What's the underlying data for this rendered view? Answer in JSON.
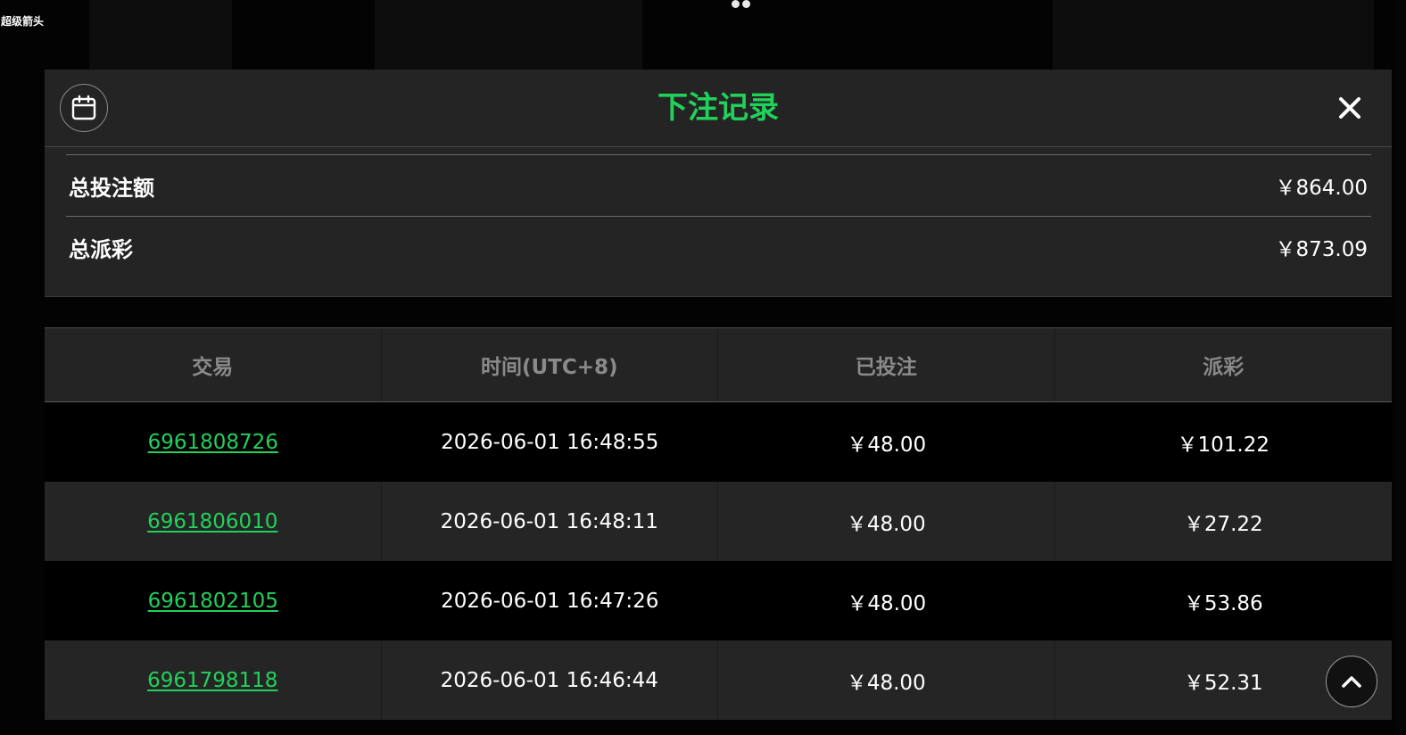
{
  "app": {
    "title": "超级箭头"
  },
  "modal": {
    "title": "下注记录",
    "calendar_icon": "calendar-icon",
    "close_icon": "close-icon",
    "accent_color": "#22d15a"
  },
  "summary": {
    "total_bet_label": "总投注额",
    "total_bet_value": "￥864.00",
    "total_payout_label": "总派彩",
    "total_payout_value": "￥873.09"
  },
  "table": {
    "headers": [
      "交易",
      "时间(UTC+8)",
      "已投注",
      "派彩"
    ],
    "rows": [
      {
        "id": "6961808726",
        "time": "2026-06-01 16:48:55",
        "bet": "￥48.00",
        "payout": "￥101.22"
      },
      {
        "id": "6961806010",
        "time": "2026-06-01 16:48:11",
        "bet": "￥48.00",
        "payout": "￥27.22"
      },
      {
        "id": "6961802105",
        "time": "2026-06-01 16:47:26",
        "bet": "￥48.00",
        "payout": "￥53.86"
      },
      {
        "id": "6961798118",
        "time": "2026-06-01 16:46:44",
        "bet": "￥48.00",
        "payout": "￥52.31"
      }
    ]
  },
  "scroll_top_icon": "chevron-up-icon"
}
